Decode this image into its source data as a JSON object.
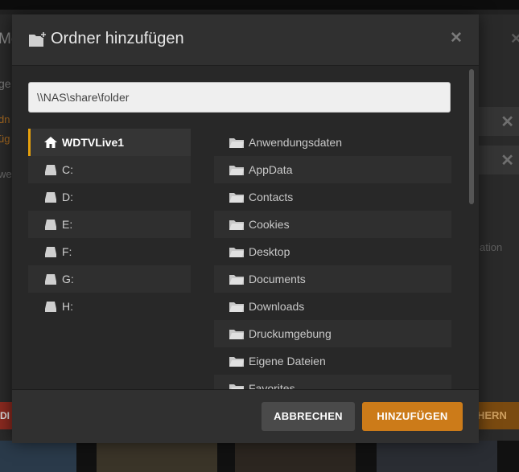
{
  "background": {
    "title_fragment": "Me",
    "line1": "ge",
    "line2": "dn",
    "line3": "üg",
    "line4": "we",
    "side_text": "ation",
    "left_button": "DI",
    "right_button": "HERN",
    "close_glyph": "✕",
    "row_close_glyph": "✕"
  },
  "modal": {
    "title": "Ordner hinzufügen",
    "close_glyph": "✕",
    "path_value": "\\\\NAS\\share\\folder",
    "drives": [
      {
        "label": "WDTVLive1",
        "icon": "home-icon",
        "selected": true
      },
      {
        "label": "C:",
        "icon": "drive-icon"
      },
      {
        "label": "D:",
        "icon": "drive-icon"
      },
      {
        "label": "E:",
        "icon": "drive-icon"
      },
      {
        "label": "F:",
        "icon": "drive-icon"
      },
      {
        "label": "G:",
        "icon": "drive-icon"
      },
      {
        "label": "H:",
        "icon": "drive-icon"
      }
    ],
    "folders": [
      {
        "label": "Anwendungsdaten"
      },
      {
        "label": "AppData"
      },
      {
        "label": "Contacts"
      },
      {
        "label": "Cookies"
      },
      {
        "label": "Desktop"
      },
      {
        "label": "Documents"
      },
      {
        "label": "Downloads"
      },
      {
        "label": "Druckumgebung"
      },
      {
        "label": "Eigene Dateien"
      },
      {
        "label": "Favorites"
      }
    ],
    "cancel_label": "ABBRECHEN",
    "add_label": "HINZUFÜGEN"
  },
  "colors": {
    "accent": "#e5a00d",
    "add_button": "#cc7b19",
    "cancel_button": "#4a4a4a",
    "modal_bg": "#282828"
  }
}
